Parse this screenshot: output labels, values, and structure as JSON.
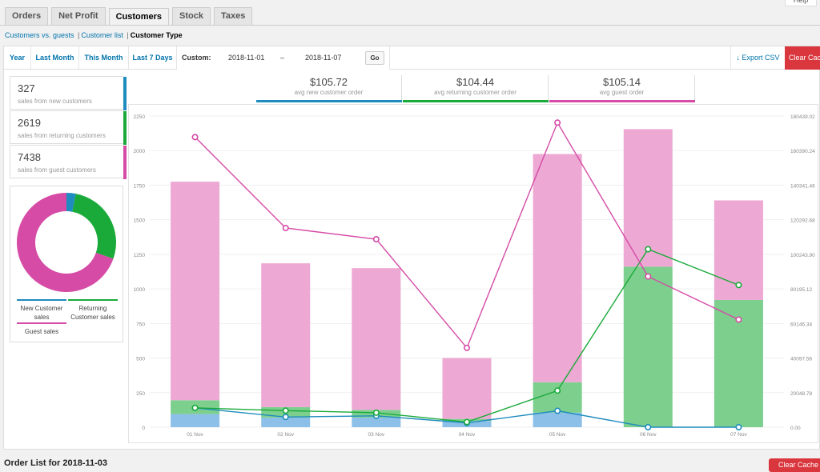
{
  "help_label": "Help",
  "tabs": [
    "Orders",
    "Net Profit",
    "Customers",
    "Stock",
    "Taxes"
  ],
  "active_tab": 2,
  "subnav": {
    "link1": "Customers vs. guests",
    "link2": "Customer list",
    "current": "Customer Type",
    "sep": "|"
  },
  "range": {
    "items": [
      "Year",
      "Last Month",
      "This Month",
      "Last 7 Days"
    ],
    "custom_label": "Custom:",
    "start_date": "2018-11-01",
    "end_date": "2018-11-07",
    "dash": "–",
    "go_label": "Go",
    "export_label": "Export CSV",
    "export_icon": "download-arrow-icon",
    "clear_label": "Clear Cache"
  },
  "legend": [
    {
      "value": "327",
      "label": "sales from new customers",
      "color": "#1e8cbe"
    },
    {
      "value": "2619",
      "label": "sales from returning customers",
      "color": "#1aaa3a"
    },
    {
      "value": "7438",
      "label": "sales from guest customers",
      "color": "#d54ba6"
    }
  ],
  "pie": {
    "legend": {
      "new": "New Customer sales",
      "returning": "Returning Customer sales",
      "guest": "Guest sales"
    }
  },
  "stats": [
    {
      "value": "$105.72",
      "label": "avg new customer order",
      "color": "#1e8cbe"
    },
    {
      "value": "$104.44",
      "label": "avg returning customer order",
      "color": "#1aaa3a"
    },
    {
      "value": "$105.14",
      "label": "avg guest order",
      "color": "#d54ba6"
    }
  ],
  "chart_data": {
    "type": "bar",
    "categories": [
      "01 Nov",
      "02 Nov",
      "03 Nov",
      "04 Nov",
      "05 Nov",
      "06 Nov",
      "07 Nov"
    ],
    "left_ticks": [
      "0",
      "250",
      "500",
      "750",
      "1000",
      "1250",
      "1500",
      "1750",
      "2000",
      "2250"
    ],
    "right_ticks": [
      "0.00",
      "20048.78",
      "40097.56",
      "60146.34",
      "80195.12",
      "100243.90",
      "120292.68",
      "140341.46",
      "160390.24",
      "180439.02"
    ],
    "ylim_left": [
      0,
      2250
    ],
    "ylim_right": [
      0,
      180439.02
    ],
    "stacked_bars": [
      {
        "name": "New Customer sales",
        "color": "#8cc0e8",
        "values": [
          95,
          70,
          70,
          45,
          105,
          0,
          0
        ]
      },
      {
        "name": "Returning Customer sales",
        "color": "#7dcf8e",
        "values": [
          100,
          75,
          55,
          15,
          220,
          1160,
          920
        ]
      },
      {
        "name": "Guest sales",
        "color": "#eda8d3",
        "values": [
          1580,
          1040,
          1025,
          440,
          1650,
          995,
          720
        ]
      }
    ],
    "lines": [
      {
        "name": "New Customer sales",
        "color": "#1e8cbe",
        "values": [
          1,
          0.87,
          0.89,
          0.3,
          1.6,
          0.04,
          0.01
        ],
        "scale_to": 180439.02
      },
      {
        "name": "Returning Customer sales",
        "color": "#1aaa3a",
        "values": [
          11200,
          9600,
          8400,
          3000,
          21200,
          103200,
          82400
        ]
      },
      {
        "name": "Guest sales",
        "color": "#d54ba6",
        "values": [
          168200,
          115500,
          109000,
          46000,
          176600,
          87400,
          62400
        ]
      }
    ],
    "line_points": [
      {
        "name": "new",
        "values": [
          11200,
          5900,
          6600,
          2500,
          9500,
          0,
          0
        ]
      }
    ]
  },
  "order_list_title": "Order List for 2018-11-03",
  "clear_bottom_label": "Clear Cache"
}
